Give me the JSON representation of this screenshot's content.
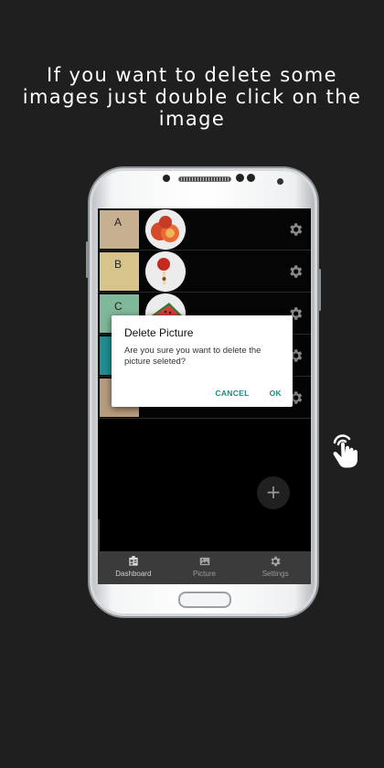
{
  "headline": "If you want to delete some images just double click on the image",
  "rows": [
    {
      "letter": "A",
      "color": "#c7b08f",
      "fruit": "peach"
    },
    {
      "letter": "B",
      "color": "#d6c48a",
      "fruit": "apple"
    },
    {
      "letter": "C",
      "color": "#7fb89a",
      "fruit": "watermelon"
    },
    {
      "letter": "",
      "color": "#1f8f93",
      "fruit": ""
    },
    {
      "letter": "",
      "color": "#b89c7e",
      "fruit": ""
    }
  ],
  "dialog": {
    "title": "Delete Picture",
    "message": "Are you sure you want to delete the picture seleted?",
    "cancel": "CANCEL",
    "ok": "OK"
  },
  "fab_label": "+",
  "nav": {
    "dashboard": "Dashboard",
    "picture": "Picture",
    "settings": "Settings"
  },
  "icons": [
    "settings-gear-icon",
    "add-icon",
    "dashboard-icon",
    "picture-icon",
    "double-tap-hand-icon"
  ]
}
